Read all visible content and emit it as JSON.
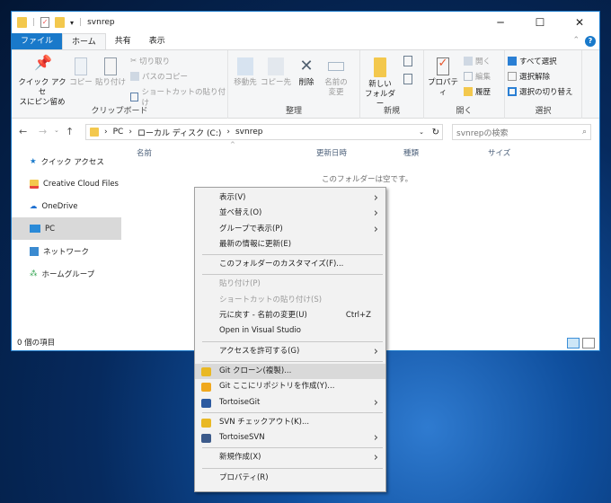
{
  "window": {
    "title": "svnrep",
    "controls": {
      "minimize": "─",
      "maximize": "☐",
      "close": "✕"
    }
  },
  "tabs": [
    {
      "label": "ファイル"
    },
    {
      "label": "ホーム"
    },
    {
      "label": "共有"
    },
    {
      "label": "表示"
    }
  ],
  "help": "?",
  "ribbon": {
    "clipboard": {
      "label": "クリップボード",
      "pin1": "クイック アクセ",
      "pin2": "スにピン留め",
      "copy": "コピー",
      "paste": "貼り付け",
      "cut": "切り取り",
      "copy_path": "パスのコピー",
      "paste_shortcut": "ショートカットの貼り付け"
    },
    "organize": {
      "label": "整理",
      "move1": "移動先",
      "copy1": "コピー先",
      "delete": "削除",
      "rename1": "名前の",
      "rename2": "変更"
    },
    "new": {
      "label": "新規",
      "folder1": "新しい",
      "folder2": "フォルダー"
    },
    "open": {
      "label": "開く",
      "properties": "プロパティ",
      "open": "開く",
      "edit": "編集",
      "history": "履歴"
    },
    "select": {
      "label": "選択",
      "all": "すべて選択",
      "none": "選択解除",
      "invert": "選択の切り替え"
    }
  },
  "address": {
    "path": [
      "PC",
      "ローカル ディスク (C:)",
      "svnrep"
    ],
    "search_placeholder": "svnrepの検索"
  },
  "nav": [
    {
      "label": "クイック アクセス",
      "color": "#1979ca"
    },
    {
      "label": "Creative Cloud Files",
      "color": "#e8453c"
    },
    {
      "label": "OneDrive",
      "color": "#1e6fd0"
    },
    {
      "label": "PC",
      "color": "#2a8ad8"
    },
    {
      "label": "ネットワーク",
      "color": "#3a8ad0"
    },
    {
      "label": "ホームグループ",
      "color": "#2aa04a"
    }
  ],
  "columns": [
    "名前",
    "更新日時",
    "種類",
    "サイズ"
  ],
  "empty_text": "このフォルダーは空です。",
  "status": "0 個の項目",
  "context_menu": [
    {
      "label": "表示(V)",
      "arrow": true
    },
    {
      "label": "並べ替え(O)",
      "arrow": true
    },
    {
      "label": "グループで表示(P)",
      "arrow": true
    },
    {
      "label": "最新の情報に更新(E)"
    },
    {
      "sep": true
    },
    {
      "label": "このフォルダーのカスタマイズ(F)..."
    },
    {
      "sep": true
    },
    {
      "label": "貼り付け(P)",
      "disabled": true
    },
    {
      "label": "ショートカットの貼り付け(S)",
      "disabled": true
    },
    {
      "label": "元に戻す - 名前の変更(U)",
      "shortcut": "Ctrl+Z"
    },
    {
      "label": "Open in Visual Studio"
    },
    {
      "sep": true
    },
    {
      "label": "アクセスを許可する(G)",
      "arrow": true
    },
    {
      "sep": true
    },
    {
      "label": "Git クローン(複製)...",
      "icon": "#e9b824",
      "highlight": true
    },
    {
      "label": "Git ここにリポジトリを作成(Y)...",
      "icon": "#f0a81e"
    },
    {
      "label": "TortoiseGit",
      "icon": "#2c5aa0",
      "arrow": true
    },
    {
      "sep": true
    },
    {
      "label": "SVN チェックアウト(K)...",
      "icon": "#e9b824"
    },
    {
      "label": "TortoiseSVN",
      "icon": "#3c5a8a",
      "arrow": true
    },
    {
      "sep": true
    },
    {
      "label": "新規作成(X)",
      "arrow": true
    },
    {
      "sep": true
    },
    {
      "label": "プロパティ(R)"
    }
  ]
}
